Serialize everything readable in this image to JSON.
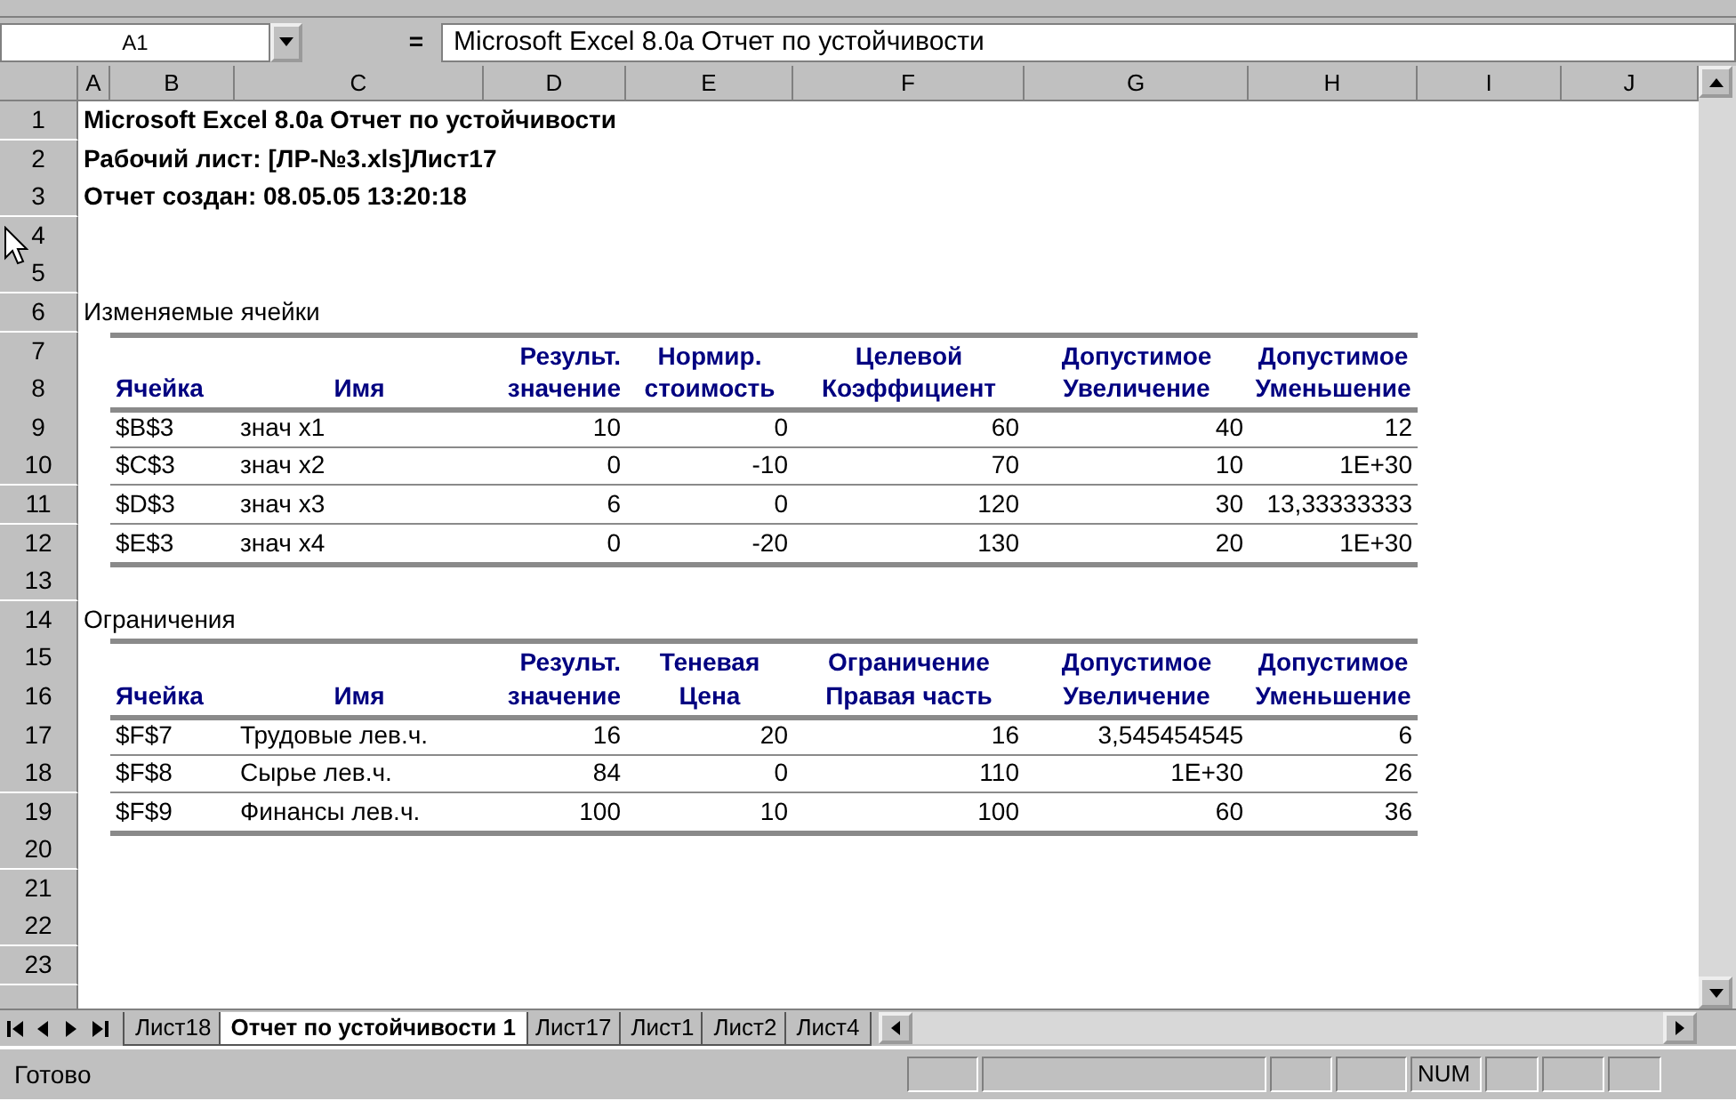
{
  "formula_bar": {
    "name_box": "A1",
    "equals": "=",
    "formula": "Microsoft Excel 8.0a Отчет по устойчивости"
  },
  "columns": [
    "A",
    "B",
    "C",
    "D",
    "E",
    "F",
    "G",
    "H",
    "I",
    "J"
  ],
  "row_numbers": [
    "1",
    "2",
    "3",
    "4",
    "5",
    "6",
    "7",
    "8",
    "9",
    "10",
    "11",
    "12",
    "13",
    "14",
    "15",
    "16",
    "17",
    "18",
    "19",
    "20",
    "21",
    "22",
    "23"
  ],
  "title_lines": [
    "Microsoft Excel 8.0a Отчет по устойчивости",
    "Рабочий лист: [ЛР-№3.xls]Лист17",
    "Отчет создан: 08.05.05 13:20:18"
  ],
  "sections": [
    {
      "title": "Изменяемые ячейки",
      "header_top": [
        "Результ.",
        "Нормир.",
        "Целевой",
        "Допустимое",
        "Допустимое"
      ],
      "header_bottom": [
        "Ячейка",
        "Имя",
        "значение",
        "стоимость",
        "Коэффициент",
        "Увеличение",
        "Уменьшение"
      ],
      "rows": [
        [
          "$B$3",
          "знач x1",
          "10",
          "0",
          "60",
          "40",
          "12"
        ],
        [
          "$C$3",
          "знач x2",
          "0",
          "-10",
          "70",
          "10",
          "1E+30"
        ],
        [
          "$D$3",
          "знач x3",
          "6",
          "0",
          "120",
          "30",
          "13,33333333"
        ],
        [
          "$E$3",
          "знач x4",
          "0",
          "-20",
          "130",
          "20",
          "1E+30"
        ]
      ]
    },
    {
      "title": "Ограничения",
      "header_top": [
        "Результ.",
        "Теневая",
        "Ограничение",
        "Допустимое",
        "Допустимое"
      ],
      "header_bottom": [
        "Ячейка",
        "Имя",
        "значение",
        "Цена",
        "Правая часть",
        "Увеличение",
        "Уменьшение"
      ],
      "rows": [
        [
          "$F$7",
          "Трудовые лев.ч.",
          "16",
          "20",
          "16",
          "3,545454545",
          "6"
        ],
        [
          "$F$8",
          "Сырье лев.ч.",
          "84",
          "0",
          "110",
          "1E+30",
          "26"
        ],
        [
          "$F$9",
          "Финансы лев.ч.",
          "100",
          "10",
          "100",
          "60",
          "36"
        ]
      ]
    }
  ],
  "sheet_tabs": [
    {
      "label": "Лист18",
      "selected": false
    },
    {
      "label": "Отчет по устойчивости 1",
      "selected": true
    },
    {
      "label": "Лист17",
      "selected": false
    },
    {
      "label": "Лист1",
      "selected": false
    },
    {
      "label": "Лист2",
      "selected": false
    },
    {
      "label": "Лист4",
      "selected": false
    }
  ],
  "status_bar": {
    "text": "Готово",
    "indicators": [
      "NUM"
    ]
  }
}
